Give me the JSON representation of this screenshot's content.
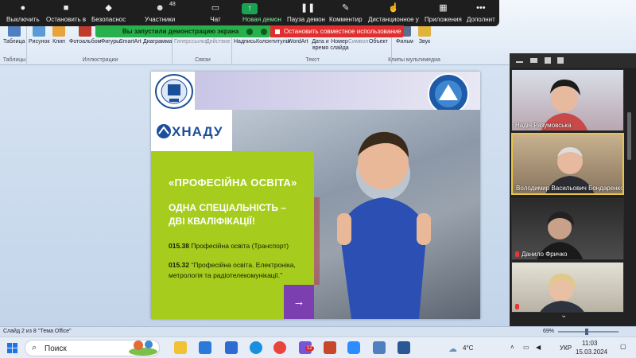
{
  "zoom_bar": {
    "buttons": [
      {
        "id": "mute",
        "label": "Выключить"
      },
      {
        "id": "video",
        "label": "Остановить в"
      },
      {
        "id": "security",
        "label": "Безопаснос"
      },
      {
        "id": "participants",
        "label": "Участники"
      },
      {
        "id": "chat",
        "label": "Чат"
      },
      {
        "id": "new-share",
        "label": "Новая демон"
      },
      {
        "id": "pause-share",
        "label": "Пауза демон"
      },
      {
        "id": "annotate",
        "label": "Комментир"
      },
      {
        "id": "remote",
        "label": "Дистанционное у"
      },
      {
        "id": "apps",
        "label": "Приложения"
      },
      {
        "id": "more",
        "label": "Дополнит"
      }
    ],
    "participant_count": "48",
    "accent": "#1aa251"
  },
  "share_banner": {
    "message": "Вы запустили демонстрацию экрана",
    "stop_label": "Остановить совместное использование"
  },
  "ribbon": {
    "buttons": [
      {
        "id": "table",
        "label": "Таблица"
      },
      {
        "id": "picture",
        "label": "Рисунок"
      },
      {
        "id": "clip",
        "label": "Клип"
      },
      {
        "id": "album",
        "label": "Фотоальбом"
      },
      {
        "id": "shapes",
        "label": "Фигуры"
      },
      {
        "id": "smartart",
        "label": "SmartArt"
      },
      {
        "id": "chart",
        "label": "Диаграмма"
      },
      {
        "id": "hyperlink",
        "label": "Гиперссылка"
      },
      {
        "id": "action",
        "label": "Действие"
      },
      {
        "id": "textbox",
        "label": "Надпись"
      },
      {
        "id": "header",
        "label": "Колонтитулы"
      },
      {
        "id": "wordart",
        "label": "WordArt"
      },
      {
        "id": "datetime",
        "label": "Дата и время"
      },
      {
        "id": "slidenum",
        "label": "Номер слайда"
      },
      {
        "id": "symbol",
        "label": "Символ"
      },
      {
        "id": "object",
        "label": "Объект"
      },
      {
        "id": "movie",
        "label": "Фильм"
      },
      {
        "id": "sound",
        "label": "Звук"
      }
    ],
    "groups": [
      "Таблицы",
      "Иллюстрации",
      "Связи",
      "Текст",
      "Клипы мультимедиа"
    ]
  },
  "slide": {
    "logo_text": "ХНАДУ",
    "title": "«ПРОФЕСІЙНА ОСВІТА»",
    "subtitle_line1": "ОДНА СПЕЦІАЛЬНІСТЬ –",
    "subtitle_line2": "ДВІ КВАЛІФІКАЦІЇ!",
    "item1_code": "015.38",
    "item1_text": " Професійна освіта (Транспорт)",
    "item2_code": "015.32",
    "item2_text_line1": " “Професійна освіта. Електроніка,",
    "item2_text_line2": "метрологія та радіотелекомунікації.”",
    "arrow": "→"
  },
  "participants": [
    {
      "name": "Надія Разумовська",
      "muted": false,
      "active": false
    },
    {
      "name": "Володимир Васильович Бондаренко",
      "muted": false,
      "active": true
    },
    {
      "name": "Данило Фричко",
      "muted": true,
      "active": false
    },
    {
      "name": "",
      "muted": true,
      "active": false
    }
  ],
  "status_bar": {
    "slide_info": "Слайд 2 из 8",
    "theme": "\"Тема Office\"",
    "zoom": "69%",
    "zoom_fraction": 0.45
  },
  "taskbar": {
    "search_label": "Поиск",
    "weather": "4°C",
    "language": "УКР",
    "time": "11:03",
    "date": "15.03.2024",
    "badge": "12"
  }
}
